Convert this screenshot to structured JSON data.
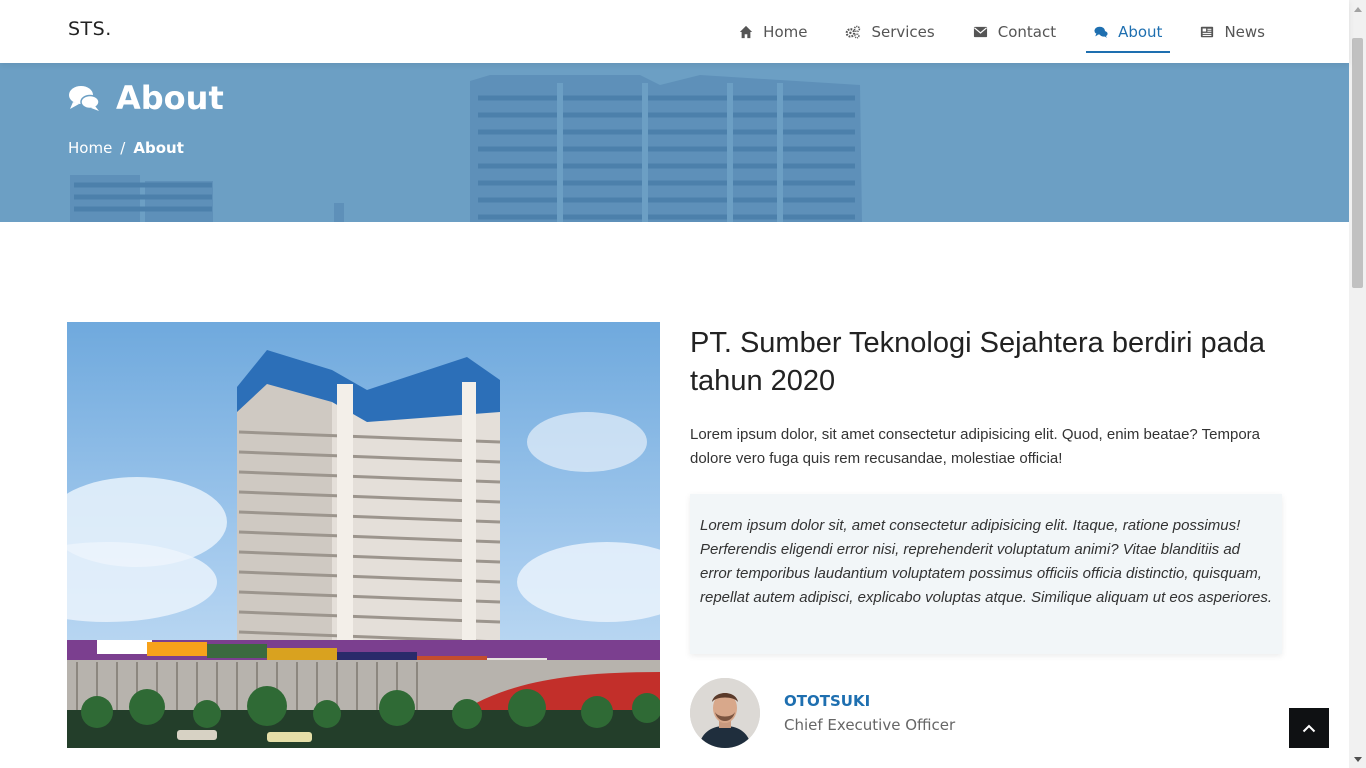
{
  "brand": "STS.",
  "nav": [
    {
      "label": "Home",
      "icon": "home-icon"
    },
    {
      "label": "Services",
      "icon": "gears-icon"
    },
    {
      "label": "Contact",
      "icon": "envelope-icon"
    },
    {
      "label": "About",
      "icon": "comments-icon"
    },
    {
      "label": "News",
      "icon": "newspaper-icon"
    }
  ],
  "active_nav": "About",
  "banner": {
    "title": "About",
    "breadcrumb": [
      "Home",
      "About"
    ]
  },
  "about": {
    "heading": "PT. Sumber Teknologi Sejahtera berdiri pada tahun 2020",
    "lead": "Lorem ipsum dolor, sit amet consectetur adipisicing elit. Quod, enim beatae? Tempora dolore vero fuga quis rem recusandae, molestiae officia!",
    "quote": "Lorem ipsum dolor sit, amet consectetur adipisicing elit. Itaque, ratione possimus! Perferendis eligendi error nisi, reprehenderit voluptatum animi? Vitae blanditiis ad error temporibus laudantium voluptatem possimus officiis officia distinctio, quisquam, repellat autem adipisci, explicabo voluptas atque. Similique aliquam ut eos asperiores.",
    "author_name": "OTOTSUKI",
    "author_role": "Chief Executive Officer"
  },
  "colors": {
    "accent": "#1e6fb0",
    "banner": "#6c9fc4",
    "quote_bg": "#f2f6f8"
  }
}
